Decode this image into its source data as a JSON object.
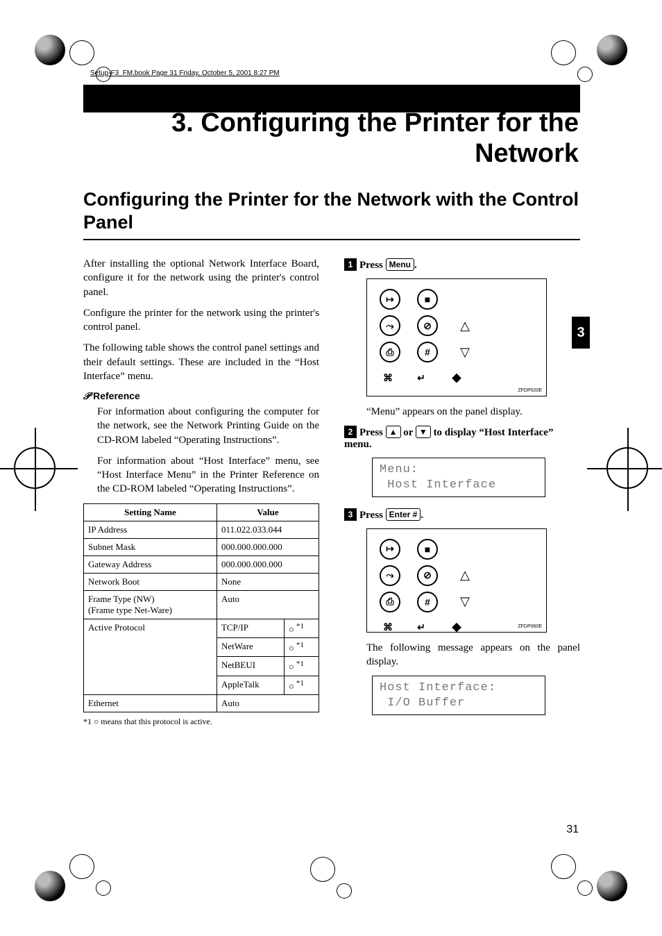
{
  "header_path": "Setup-F3_FM.book  Page 31  Friday, October 5, 2001  8:27 PM",
  "chapter_title": "3. Configuring the Printer for the Network",
  "section_title": "Configuring the Printer for the Network with the Control Panel",
  "side_tab": "3",
  "page_number": "31",
  "intro": {
    "p1": "After installing the optional Network Interface Board, configure it for the network using the printer's control panel.",
    "p2": "Configure the printer for the network using the printer's control panel.",
    "p3": "The following table shows the control panel settings and their default settings. These are included in the “Host Interface” menu."
  },
  "reference": {
    "heading": "Reference",
    "p1": "For information about configuring the computer for the network, see the Network Printing Guide on the CD-ROM labeled “Operating Instructions”.",
    "p2": "For information about “Host Interface” menu, see “Host Interface Menu” in the Printer Reference on the CD-ROM labeled “Operating Instructions”."
  },
  "settings_table": {
    "cols": [
      "Setting Name",
      "Value"
    ],
    "rows": [
      {
        "name": "IP Address",
        "value": "011.022.033.044"
      },
      {
        "name": "Subnet Mask",
        "value": "000.000.000.000"
      },
      {
        "name": "Gateway Address",
        "value": "000.000.000.000"
      },
      {
        "name": "Network Boot",
        "value": "None"
      },
      {
        "name": "Frame Type (NW)\n(Frame type Net-Ware)",
        "value": "Auto"
      }
    ],
    "active_protocol": {
      "name": "Active Protocol",
      "entries": [
        {
          "proto": "TCP/IP",
          "mark": "○",
          "note": "*1"
        },
        {
          "proto": "NetWare",
          "mark": "○",
          "note": "*1"
        },
        {
          "proto": "NetBEUI",
          "mark": "○",
          "note": "*1"
        },
        {
          "proto": "AppleTalk",
          "mark": "○",
          "note": "*1"
        }
      ]
    },
    "ethernet": {
      "name": "Ethernet",
      "value": "Auto"
    }
  },
  "footnote": "*1   ○ means that this protocol is active.",
  "steps": {
    "s1": {
      "num": "1",
      "pre": "Press ",
      "key": "Menu",
      "post": "."
    },
    "fig1_caption": "ZFDP020E",
    "s1_caption": "“Menu” appears on the panel display.",
    "s2": {
      "num": "2",
      "pre": "Press ",
      "key1": "▲",
      "mid": " or ",
      "key2": "▼",
      "post": " to display “Host Interface” menu."
    },
    "lcd1_line1": "Menu:",
    "lcd1_line2": " Host Interface",
    "s3": {
      "num": "3",
      "pre": "Press ",
      "key": "Enter #",
      "post": "."
    },
    "fig2_caption": "ZFDP060E",
    "s3_caption": "The following message appears on the panel display.",
    "lcd2_line1": "Host Interface:",
    "lcd2_line2": " I/O Buffer"
  },
  "panel_icons": {
    "row1": [
      "↦",
      "■"
    ],
    "row2": [
      "⤳",
      "⊘"
    ],
    "row3": [
      "⎙",
      "#"
    ],
    "row4": [
      "⌘",
      "↵"
    ]
  }
}
